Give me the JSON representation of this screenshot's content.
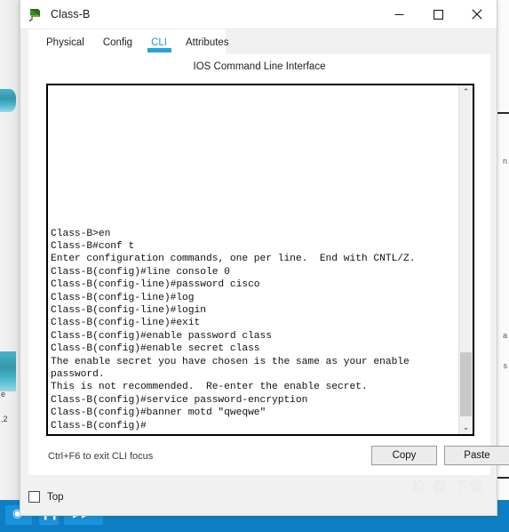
{
  "window": {
    "title": "Class-B",
    "icon": "device-switch-icon",
    "controls": {
      "minimize": "—",
      "maximize": "☐",
      "close": "✕"
    }
  },
  "tabs": [
    {
      "label": "Physical",
      "active": false
    },
    {
      "label": "Config",
      "active": false
    },
    {
      "label": "CLI",
      "active": true
    },
    {
      "label": "Attributes",
      "active": false
    }
  ],
  "panel": {
    "title": "IOS Command Line Interface"
  },
  "terminal": {
    "lines": [
      "Class-B>en",
      "Class-B#conf t",
      "Enter configuration commands, one per line.  End with CNTL/Z.",
      "Class-B(config)#line console 0",
      "Class-B(config-line)#password cisco",
      "Class-B(config-line)#log",
      "Class-B(config-line)#login",
      "Class-B(config-line)#exit",
      "Class-B(config)#enable password class",
      "Class-B(config)#enable secret class",
      "The enable secret you have chosen is the same as your enable",
      "password.",
      "This is not recommended.  Re-enter the enable secret.",
      "Class-B(config)#service password-encryption",
      "Class-B(config)#banner motd \"qweqwe\"",
      "Class-B(config)#"
    ],
    "scroll_up_glyph": "⌃",
    "scroll_down_glyph": "⌄"
  },
  "footer": {
    "hint": "Ctrl+F6 to exit CLI focus",
    "copy_label": "Copy",
    "paste_label": "Paste"
  },
  "top_option": {
    "label": "Top",
    "checked": false
  },
  "watermark": {
    "text": "价 盘 下载"
  },
  "background": {
    "left_fragments": [
      "e",
      ".2"
    ],
    "right_fragments": [
      "n",
      "a",
      "s"
    ]
  },
  "colors": {
    "accent": "#29a4da",
    "active_tab_text": "#2596c9",
    "terminal_bg": "#ffffff",
    "terminal_text": "#111111",
    "dialog_bg": "#f1f1f1",
    "taskbar_blue": "#0f7fc4"
  }
}
